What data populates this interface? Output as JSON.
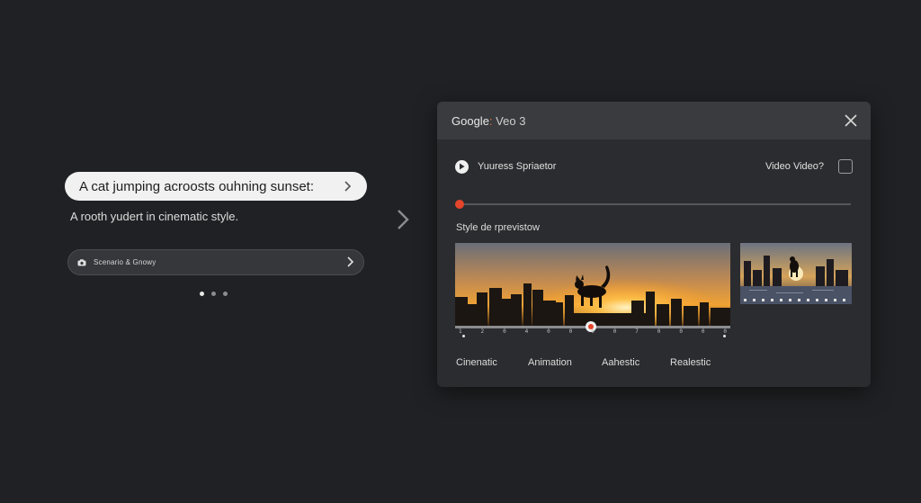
{
  "left": {
    "prompt": "A cat jumping acroosts ouhning sunset:",
    "subtext": "A rooth yudert in cinematic style.",
    "scenario_label": "Scenario & Gnowy",
    "dots": 3
  },
  "dialog": {
    "brand_google": "Google",
    "brand_sep": ":",
    "brand_product": "Veo 3",
    "toggle_label": "Yuuress Spriaetor",
    "checkbox_label": "Video Video?",
    "style_preview_label": "Style de rprevistow",
    "ticks": [
      "1",
      "2",
      "0",
      "4",
      "0",
      "0",
      "0",
      "0",
      "7",
      "0",
      "0",
      "0",
      "0"
    ],
    "styles": [
      "Cinenatic",
      "Animation",
      "Aahestic",
      "Realestic"
    ],
    "accent": "#e4452b"
  }
}
